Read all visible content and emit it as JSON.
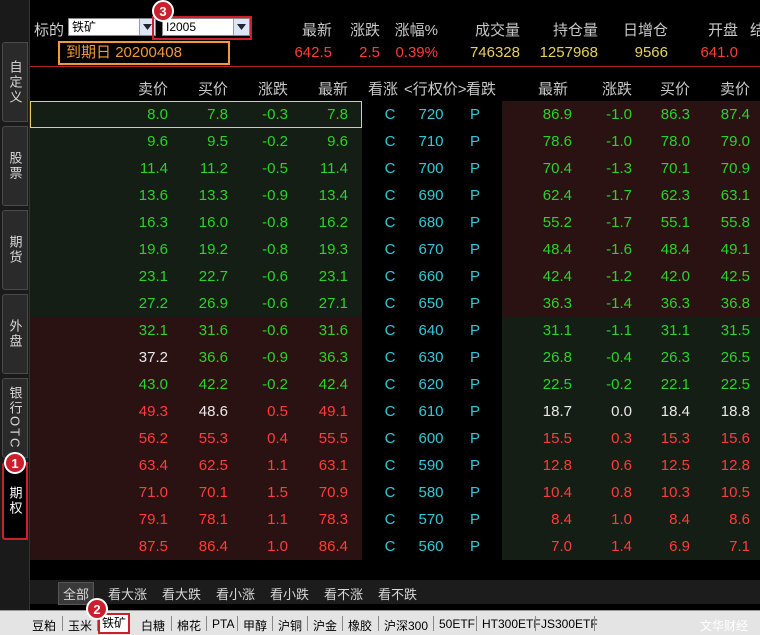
{
  "left_tabs": [
    "自定义",
    "股票",
    "期货",
    "外盘",
    "银行OTC",
    "期权"
  ],
  "header": {
    "underlying_label": "标的",
    "underlying_value": "铁矿",
    "contract_value": "I2005",
    "expiry_label": "到期日",
    "expiry_value": "20200408",
    "columns": [
      "最新",
      "涨跌",
      "涨幅%",
      "成交量",
      "持仓量",
      "日增仓",
      "开盘",
      "结"
    ],
    "values": [
      "642.5",
      "2.5",
      "0.39%",
      "746328",
      "1257968",
      "9566",
      "641.0"
    ]
  },
  "table_headers": {
    "call": [
      "卖价",
      "买价",
      "涨跌",
      "最新"
    ],
    "middle": [
      "看涨",
      "<行权价>",
      "看跌"
    ],
    "put": [
      "最新",
      "涨跌",
      "买价",
      "卖价"
    ]
  },
  "rows": [
    {
      "c_ask": "8.0",
      "c_bid": "7.8",
      "c_chg": "-0.3",
      "c_last": "7.8",
      "call": "C",
      "strike": "720",
      "put": "P",
      "p_last": "86.9",
      "p_chg": "-1.0",
      "p_bid": "86.3",
      "p_ask": "87.4"
    },
    {
      "c_ask": "9.6",
      "c_bid": "9.5",
      "c_chg": "-0.2",
      "c_last": "9.6",
      "call": "C",
      "strike": "710",
      "put": "P",
      "p_last": "78.6",
      "p_chg": "-1.0",
      "p_bid": "78.0",
      "p_ask": "79.0"
    },
    {
      "c_ask": "11.4",
      "c_bid": "11.2",
      "c_chg": "-0.5",
      "c_last": "11.4",
      "call": "C",
      "strike": "700",
      "put": "P",
      "p_last": "70.4",
      "p_chg": "-1.3",
      "p_bid": "70.1",
      "p_ask": "70.9"
    },
    {
      "c_ask": "13.6",
      "c_bid": "13.3",
      "c_chg": "-0.9",
      "c_last": "13.4",
      "call": "C",
      "strike": "690",
      "put": "P",
      "p_last": "62.4",
      "p_chg": "-1.7",
      "p_bid": "62.3",
      "p_ask": "63.1"
    },
    {
      "c_ask": "16.3",
      "c_bid": "16.0",
      "c_chg": "-0.8",
      "c_last": "16.2",
      "call": "C",
      "strike": "680",
      "put": "P",
      "p_last": "55.2",
      "p_chg": "-1.7",
      "p_bid": "55.1",
      "p_ask": "55.8"
    },
    {
      "c_ask": "19.6",
      "c_bid": "19.2",
      "c_chg": "-0.8",
      "c_last": "19.3",
      "call": "C",
      "strike": "670",
      "put": "P",
      "p_last": "48.4",
      "p_chg": "-1.6",
      "p_bid": "48.4",
      "p_ask": "49.1"
    },
    {
      "c_ask": "23.1",
      "c_bid": "22.7",
      "c_chg": "-0.6",
      "c_last": "23.1",
      "call": "C",
      "strike": "660",
      "put": "P",
      "p_last": "42.4",
      "p_chg": "-1.2",
      "p_bid": "42.0",
      "p_ask": "42.5"
    },
    {
      "c_ask": "27.2",
      "c_bid": "26.9",
      "c_chg": "-0.6",
      "c_last": "27.1",
      "call": "C",
      "strike": "650",
      "put": "P",
      "p_last": "36.3",
      "p_chg": "-1.4",
      "p_bid": "36.3",
      "p_ask": "36.8"
    },
    {
      "c_ask": "32.1",
      "c_bid": "31.6",
      "c_chg": "-0.6",
      "c_last": "31.6",
      "call": "C",
      "strike": "640",
      "put": "P",
      "p_last": "31.1",
      "p_chg": "-1.1",
      "p_bid": "31.1",
      "p_ask": "31.5"
    },
    {
      "c_ask": "37.2",
      "c_bid": "36.6",
      "c_chg": "-0.9",
      "c_last": "36.3",
      "call": "C",
      "strike": "630",
      "put": "P",
      "p_last": "26.8",
      "p_chg": "-0.4",
      "p_bid": "26.3",
      "p_ask": "26.5"
    },
    {
      "c_ask": "43.0",
      "c_bid": "42.2",
      "c_chg": "-0.2",
      "c_last": "42.4",
      "call": "C",
      "strike": "620",
      "put": "P",
      "p_last": "22.5",
      "p_chg": "-0.2",
      "p_bid": "22.1",
      "p_ask": "22.5"
    },
    {
      "c_ask": "49.3",
      "c_bid": "48.6",
      "c_chg": "0.5",
      "c_last": "49.1",
      "call": "C",
      "strike": "610",
      "put": "P",
      "p_last": "18.7",
      "p_chg": "0.0",
      "p_bid": "18.4",
      "p_ask": "18.8"
    },
    {
      "c_ask": "56.2",
      "c_bid": "55.3",
      "c_chg": "0.4",
      "c_last": "55.5",
      "call": "C",
      "strike": "600",
      "put": "P",
      "p_last": "15.5",
      "p_chg": "0.3",
      "p_bid": "15.3",
      "p_ask": "15.6"
    },
    {
      "c_ask": "63.4",
      "c_bid": "62.5",
      "c_chg": "1.1",
      "c_last": "63.1",
      "call": "C",
      "strike": "590",
      "put": "P",
      "p_last": "12.8",
      "p_chg": "0.6",
      "p_bid": "12.5",
      "p_ask": "12.8"
    },
    {
      "c_ask": "71.0",
      "c_bid": "70.1",
      "c_chg": "1.5",
      "c_last": "70.9",
      "call": "C",
      "strike": "580",
      "put": "P",
      "p_last": "10.4",
      "p_chg": "0.8",
      "p_bid": "10.3",
      "p_ask": "10.5"
    },
    {
      "c_ask": "79.1",
      "c_bid": "78.1",
      "c_chg": "1.1",
      "c_last": "78.3",
      "call": "C",
      "strike": "570",
      "put": "P",
      "p_last": "8.4",
      "p_chg": "1.0",
      "p_bid": "8.4",
      "p_ask": "8.6"
    },
    {
      "c_ask": "87.5",
      "c_bid": "86.4",
      "c_chg": "1.0",
      "c_last": "86.4",
      "call": "C",
      "strike": "560",
      "put": "P",
      "p_last": "7.0",
      "p_chg": "1.4",
      "p_bid": "6.9",
      "p_ask": "7.1"
    }
  ],
  "filters": [
    "全部",
    "看大涨",
    "看大跌",
    "看小涨",
    "看小跌",
    "看不涨",
    "看不跌"
  ],
  "bottom_tabs": [
    "豆粕",
    "玉米",
    "铁矿",
    "白糖",
    "棉花",
    "PTA",
    "甲醇",
    "沪铜",
    "沪金",
    "橡胶",
    "沪深300",
    "50ETF",
    "HT300ETF",
    "JS300ETF"
  ],
  "brand": "文华财经",
  "markers": [
    "1",
    "2",
    "3"
  ],
  "colors": {
    "up": "#ff3c3c",
    "down": "#2ed02e",
    "flat": "#e8e8e8",
    "strike": "#33c8d8",
    "accent": "#cc1e2c",
    "expiry": "#f29a38"
  }
}
